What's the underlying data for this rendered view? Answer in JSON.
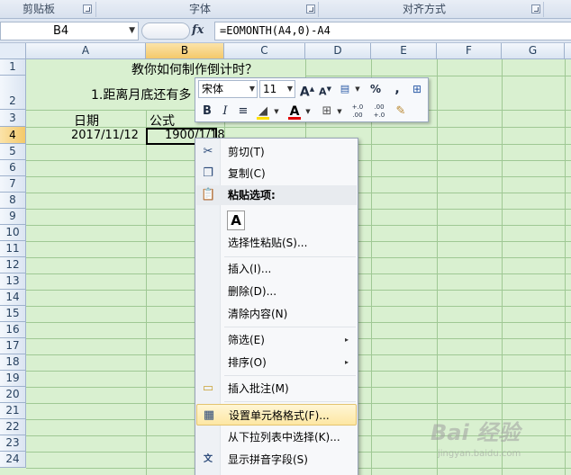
{
  "ribbon": {
    "groups": [
      "剪贴板",
      "字体",
      "对齐方式"
    ]
  },
  "formula_bar": {
    "name_box": "B4",
    "fx_label": "fx",
    "formula": "=EOMONTH(A4,0)-A4"
  },
  "sheet": {
    "columns": [
      "A",
      "B",
      "C",
      "D",
      "E",
      "F",
      "G"
    ],
    "selected_column": "B",
    "rows": [
      "1",
      "2",
      "3",
      "4",
      "5",
      "6",
      "7",
      "8",
      "9",
      "10",
      "11",
      "12",
      "13",
      "14",
      "15",
      "16",
      "17",
      "18",
      "19",
      "20",
      "21",
      "22",
      "23",
      "24"
    ],
    "selected_row": "4",
    "title": "教你如何制作倒计时？",
    "subtitle": "1.距离月底还有多",
    "a3": "日期",
    "b3": "公式",
    "a4": "2017/11/12",
    "b4": "1900/1/18"
  },
  "mini_toolbar": {
    "font_name": "宋体",
    "font_size": "11",
    "grow_font": "A",
    "shrink_font": "A",
    "percent": "%",
    "comma": ",",
    "bold": "B",
    "italic": "I",
    "font_color_label": "A",
    "inc_decimal": "+.0\n.00",
    "dec_decimal": ".00\n+.0"
  },
  "context_menu": {
    "items": [
      {
        "label": "剪切(T)",
        "icon": "scissors-icon"
      },
      {
        "label": "复制(C)",
        "icon": "copy-icon"
      },
      {
        "label": "粘贴选项:",
        "icon": "paste-icon"
      },
      {
        "label": "A",
        "icon": "paste-values-icon"
      },
      {
        "label": "选择性粘贴(S)...",
        "icon": ""
      },
      {
        "label": "插入(I)...",
        "icon": ""
      },
      {
        "label": "删除(D)...",
        "icon": ""
      },
      {
        "label": "清除内容(N)",
        "icon": ""
      },
      {
        "label": "筛选(E)",
        "icon": ""
      },
      {
        "label": "排序(O)",
        "icon": ""
      },
      {
        "label": "插入批注(M)",
        "icon": "comment-icon"
      },
      {
        "label": "设置单元格格式(F)...",
        "icon": "format-cells-icon"
      },
      {
        "label": "从下拉列表中选择(K)...",
        "icon": ""
      },
      {
        "label": "显示拼音字段(S)",
        "icon": "phonetic-icon"
      }
    ],
    "submenu_arrow": "▸"
  },
  "watermark": {
    "logo": "Bai 经验",
    "url": "jingyan.baidu.com"
  },
  "colors": {
    "grid_bg": "#d9f0d0",
    "highlight": "#fde7a3",
    "header_bg": "#dbe5f2"
  }
}
